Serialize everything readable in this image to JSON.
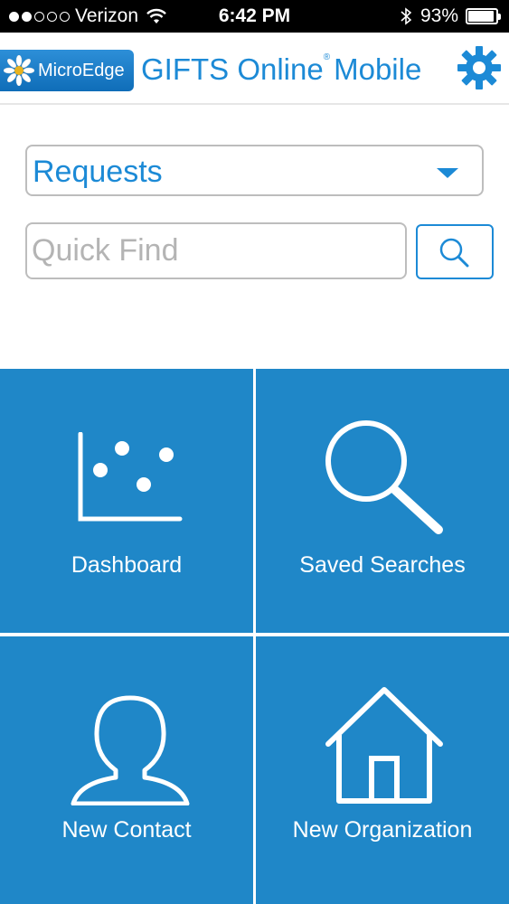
{
  "status_bar": {
    "carrier": "Verizon",
    "time": "6:42 PM",
    "battery_percent": "93%",
    "battery_level": 0.93,
    "signal_bars_filled": 2,
    "signal_bars_total": 5
  },
  "header": {
    "logo_text": "MicroEdge",
    "title_bold": "GIFTS Online",
    "title_trademark": "®",
    "title_light": "Mobile"
  },
  "search": {
    "category_value": "Requests",
    "quick_find_placeholder": "Quick Find"
  },
  "tiles": [
    {
      "label": "Dashboard",
      "icon": "scatter-chart-icon"
    },
    {
      "label": "Saved Searches",
      "icon": "magnifier-icon"
    },
    {
      "label": "New Contact",
      "icon": "person-icon"
    },
    {
      "label": "New Organization",
      "icon": "house-icon"
    }
  ],
  "colors": {
    "accent": "#1c8ad6",
    "tile_background": "#1f87c8",
    "status_bar": "#000000"
  }
}
